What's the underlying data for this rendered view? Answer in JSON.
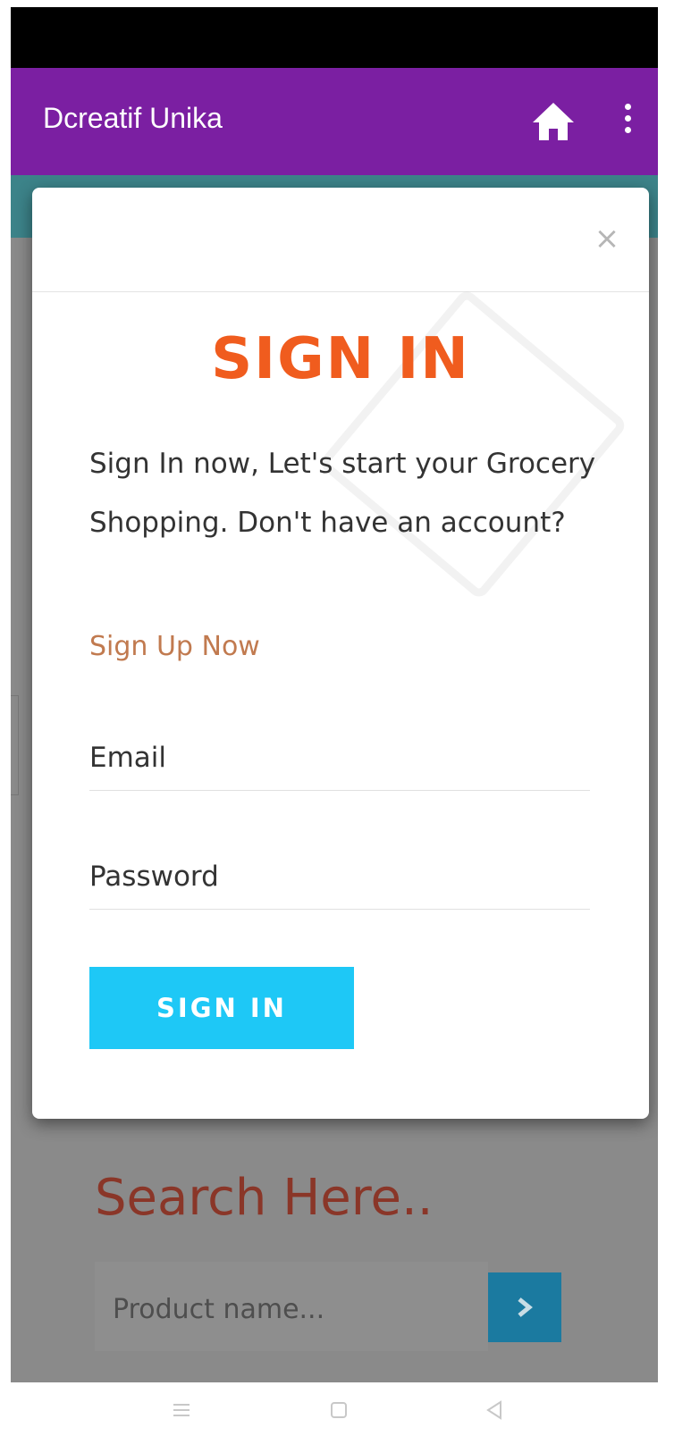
{
  "app_bar": {
    "title": "Dcreatif Unika",
    "color": "#7b1fa2",
    "icons": [
      "home-icon",
      "more-vert-icon"
    ]
  },
  "signin_modal": {
    "heading": "SIGN IN",
    "description": "Sign In now, Let's start your Grocery Shopping. Don't have an account?",
    "signup_link": "Sign Up Now",
    "email_placeholder": "Email",
    "password_placeholder": "Password",
    "submit_label": "SIGN IN",
    "heading_color": "#f05c1e",
    "button_color": "#1ec8f6",
    "close_icon": "close-icon"
  },
  "search_section": {
    "title": "Search Here..",
    "input_placeholder": "Product name...",
    "go_icon": "chevron-right-icon"
  },
  "nav_bar": {
    "icons": [
      "menu-icon",
      "home-square-icon",
      "back-triangle-icon"
    ]
  }
}
